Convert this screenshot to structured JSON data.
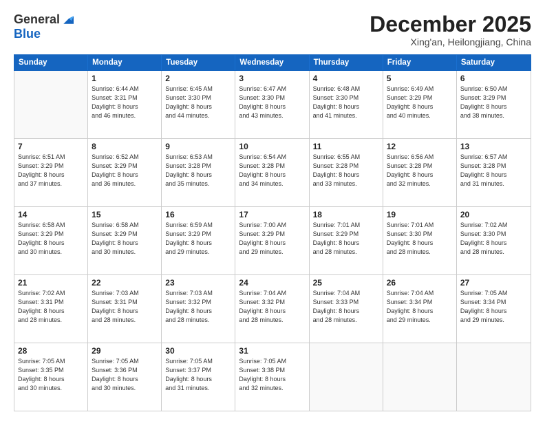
{
  "logo": {
    "general": "General",
    "blue": "Blue"
  },
  "title": "December 2025",
  "location": "Xing'an, Heilongjiang, China",
  "days": [
    "Sunday",
    "Monday",
    "Tuesday",
    "Wednesday",
    "Thursday",
    "Friday",
    "Saturday"
  ],
  "weeks": [
    [
      {
        "day": "",
        "info": ""
      },
      {
        "day": "1",
        "info": "Sunrise: 6:44 AM\nSunset: 3:31 PM\nDaylight: 8 hours\nand 46 minutes."
      },
      {
        "day": "2",
        "info": "Sunrise: 6:45 AM\nSunset: 3:30 PM\nDaylight: 8 hours\nand 44 minutes."
      },
      {
        "day": "3",
        "info": "Sunrise: 6:47 AM\nSunset: 3:30 PM\nDaylight: 8 hours\nand 43 minutes."
      },
      {
        "day": "4",
        "info": "Sunrise: 6:48 AM\nSunset: 3:30 PM\nDaylight: 8 hours\nand 41 minutes."
      },
      {
        "day": "5",
        "info": "Sunrise: 6:49 AM\nSunset: 3:29 PM\nDaylight: 8 hours\nand 40 minutes."
      },
      {
        "day": "6",
        "info": "Sunrise: 6:50 AM\nSunset: 3:29 PM\nDaylight: 8 hours\nand 38 minutes."
      }
    ],
    [
      {
        "day": "7",
        "info": "Sunrise: 6:51 AM\nSunset: 3:29 PM\nDaylight: 8 hours\nand 37 minutes."
      },
      {
        "day": "8",
        "info": "Sunrise: 6:52 AM\nSunset: 3:29 PM\nDaylight: 8 hours\nand 36 minutes."
      },
      {
        "day": "9",
        "info": "Sunrise: 6:53 AM\nSunset: 3:28 PM\nDaylight: 8 hours\nand 35 minutes."
      },
      {
        "day": "10",
        "info": "Sunrise: 6:54 AM\nSunset: 3:28 PM\nDaylight: 8 hours\nand 34 minutes."
      },
      {
        "day": "11",
        "info": "Sunrise: 6:55 AM\nSunset: 3:28 PM\nDaylight: 8 hours\nand 33 minutes."
      },
      {
        "day": "12",
        "info": "Sunrise: 6:56 AM\nSunset: 3:28 PM\nDaylight: 8 hours\nand 32 minutes."
      },
      {
        "day": "13",
        "info": "Sunrise: 6:57 AM\nSunset: 3:28 PM\nDaylight: 8 hours\nand 31 minutes."
      }
    ],
    [
      {
        "day": "14",
        "info": "Sunrise: 6:58 AM\nSunset: 3:29 PM\nDaylight: 8 hours\nand 30 minutes."
      },
      {
        "day": "15",
        "info": "Sunrise: 6:58 AM\nSunset: 3:29 PM\nDaylight: 8 hours\nand 30 minutes."
      },
      {
        "day": "16",
        "info": "Sunrise: 6:59 AM\nSunset: 3:29 PM\nDaylight: 8 hours\nand 29 minutes."
      },
      {
        "day": "17",
        "info": "Sunrise: 7:00 AM\nSunset: 3:29 PM\nDaylight: 8 hours\nand 29 minutes."
      },
      {
        "day": "18",
        "info": "Sunrise: 7:01 AM\nSunset: 3:29 PM\nDaylight: 8 hours\nand 28 minutes."
      },
      {
        "day": "19",
        "info": "Sunrise: 7:01 AM\nSunset: 3:30 PM\nDaylight: 8 hours\nand 28 minutes."
      },
      {
        "day": "20",
        "info": "Sunrise: 7:02 AM\nSunset: 3:30 PM\nDaylight: 8 hours\nand 28 minutes."
      }
    ],
    [
      {
        "day": "21",
        "info": "Sunrise: 7:02 AM\nSunset: 3:31 PM\nDaylight: 8 hours\nand 28 minutes."
      },
      {
        "day": "22",
        "info": "Sunrise: 7:03 AM\nSunset: 3:31 PM\nDaylight: 8 hours\nand 28 minutes."
      },
      {
        "day": "23",
        "info": "Sunrise: 7:03 AM\nSunset: 3:32 PM\nDaylight: 8 hours\nand 28 minutes."
      },
      {
        "day": "24",
        "info": "Sunrise: 7:04 AM\nSunset: 3:32 PM\nDaylight: 8 hours\nand 28 minutes."
      },
      {
        "day": "25",
        "info": "Sunrise: 7:04 AM\nSunset: 3:33 PM\nDaylight: 8 hours\nand 28 minutes."
      },
      {
        "day": "26",
        "info": "Sunrise: 7:04 AM\nSunset: 3:34 PM\nDaylight: 8 hours\nand 29 minutes."
      },
      {
        "day": "27",
        "info": "Sunrise: 7:05 AM\nSunset: 3:34 PM\nDaylight: 8 hours\nand 29 minutes."
      }
    ],
    [
      {
        "day": "28",
        "info": "Sunrise: 7:05 AM\nSunset: 3:35 PM\nDaylight: 8 hours\nand 30 minutes."
      },
      {
        "day": "29",
        "info": "Sunrise: 7:05 AM\nSunset: 3:36 PM\nDaylight: 8 hours\nand 30 minutes."
      },
      {
        "day": "30",
        "info": "Sunrise: 7:05 AM\nSunset: 3:37 PM\nDaylight: 8 hours\nand 31 minutes."
      },
      {
        "day": "31",
        "info": "Sunrise: 7:05 AM\nSunset: 3:38 PM\nDaylight: 8 hours\nand 32 minutes."
      },
      {
        "day": "",
        "info": ""
      },
      {
        "day": "",
        "info": ""
      },
      {
        "day": "",
        "info": ""
      }
    ]
  ]
}
